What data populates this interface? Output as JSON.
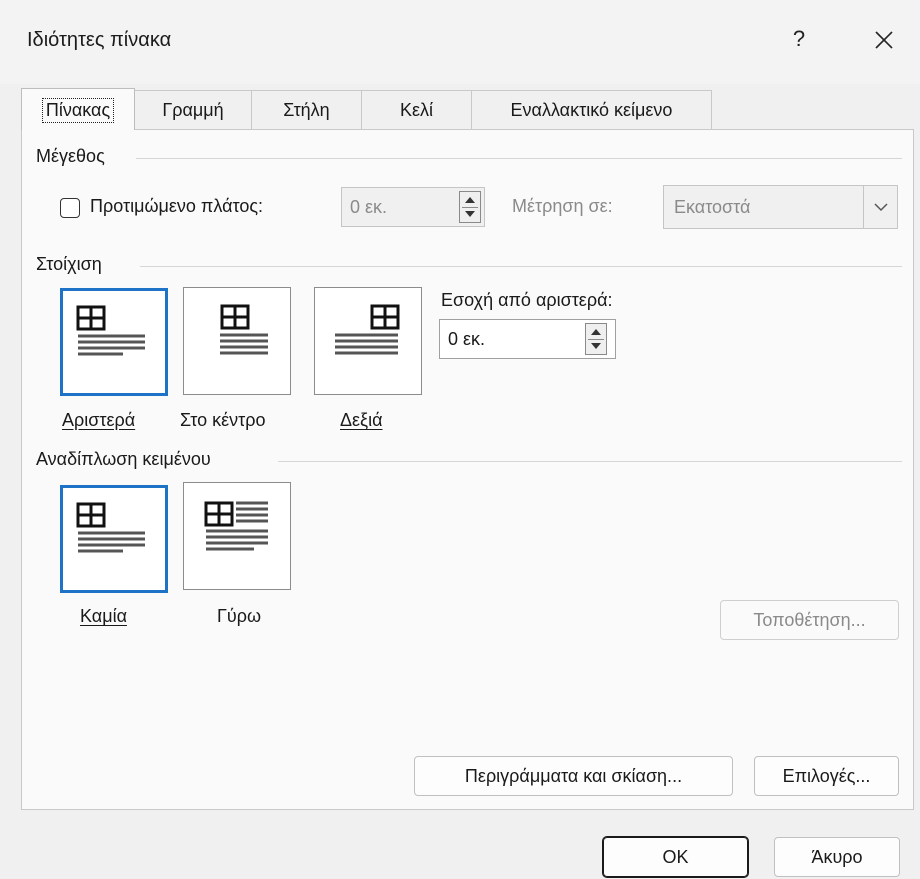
{
  "window": {
    "title": "Ιδιότητες πίνακα",
    "help_label": "?",
    "close_icon": "close-icon"
  },
  "tabs": [
    {
      "label": "Πίνακας",
      "active": true
    },
    {
      "label": "Γραμμή",
      "active": false
    },
    {
      "label": "Στήλη",
      "active": false
    },
    {
      "label": "Κελί",
      "active": false
    },
    {
      "label": "Εναλλακτικό κείμενο",
      "active": false
    }
  ],
  "size": {
    "heading": "Μέγεθος",
    "preferred_width_label": "Προτιμώμενο πλάτος:",
    "preferred_width_checked": false,
    "preferred_width_value": "0 εκ.",
    "measure_in_label": "Μέτρηση σε:",
    "measure_in_value": "Εκατοστά"
  },
  "alignment": {
    "heading": "Στοίχιση",
    "options": [
      {
        "label": "Αριστερά",
        "selected": true
      },
      {
        "label": "Στο κέντρο",
        "selected": false
      },
      {
        "label": "Δεξιά",
        "selected": false
      }
    ],
    "indent_label": "Εσοχή από αριστερά:",
    "indent_value": "0 εκ."
  },
  "wrapping": {
    "heading": "Αναδίπλωση κειμένου",
    "options": [
      {
        "label": "Καμία",
        "selected": true
      },
      {
        "label": "Γύρω",
        "selected": false
      }
    ],
    "positioning_button": "Τοποθέτηση..."
  },
  "buttons": {
    "borders_shading": "Περιγράμματα και σκίαση...",
    "options": "Επιλογές...",
    "ok": "OK",
    "cancel": "Άκυρο"
  },
  "colors": {
    "accent": "#1e73c7",
    "background": "#f0f0f0",
    "panel": "#fafafa"
  }
}
